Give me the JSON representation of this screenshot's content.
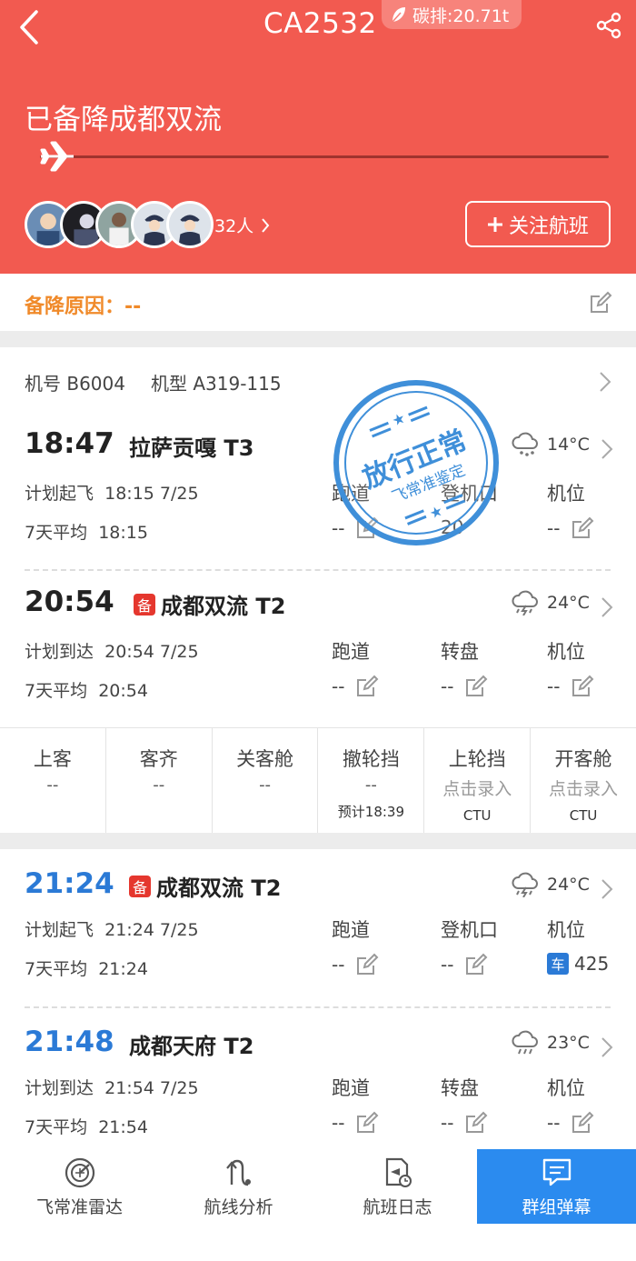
{
  "header": {
    "flight_no": "CA2532",
    "carbon": "碳排:20.71t",
    "status": "已备降成都双流",
    "progress": 0.03,
    "followers": "32人",
    "follow_label": "关注航班"
  },
  "diversion": {
    "label": "备降原因：",
    "value": "--"
  },
  "aircraft": {
    "reg_label": "机号",
    "reg": "B6004",
    "type_label": "机型",
    "type": "A319-115"
  },
  "departure": {
    "time": "18:47",
    "airport": "拉萨贡嘎 T3",
    "temp": "14°C",
    "plan_label": "计划起飞",
    "plan_value": "18:15 7/25",
    "avg_label": "7天平均",
    "avg_value": "18:15",
    "cols": [
      {
        "label": "跑道",
        "value": "--"
      },
      {
        "label": "登机口",
        "value": "20"
      },
      {
        "label": "机位",
        "value": "--"
      }
    ]
  },
  "arrival": {
    "time": "20:54",
    "divert_tag": "备",
    "airport": "成都双流 T2",
    "temp": "24°C",
    "plan_label": "计划到达",
    "plan_value": "20:54 7/25",
    "avg_label": "7天平均",
    "avg_value": "20:54",
    "cols": [
      {
        "label": "跑道",
        "value": "--"
      },
      {
        "label": "转盘",
        "value": "--"
      },
      {
        "label": "机位",
        "value": "--"
      }
    ]
  },
  "milestones": [
    {
      "title": "上客",
      "value": "--",
      "sub": ""
    },
    {
      "title": "客齐",
      "value": "--",
      "sub": ""
    },
    {
      "title": "关客舱",
      "value": "--",
      "sub": ""
    },
    {
      "title": "撤轮挡",
      "value": "--",
      "sub": "预计18:39"
    },
    {
      "title": "上轮挡",
      "value": "点击录入",
      "sub": "CTU"
    },
    {
      "title": "开客舱",
      "value": "点击录入",
      "sub": "CTU"
    }
  ],
  "leg2_departure": {
    "time": "21:24",
    "divert_tag": "备",
    "airport": "成都双流 T2",
    "temp": "24°C",
    "plan_label": "计划起飞",
    "plan_value": "21:24 7/25",
    "avg_label": "7天平均",
    "avg_value": "21:24",
    "cols": [
      {
        "label": "跑道",
        "value": "--"
      },
      {
        "label": "登机口",
        "value": "--"
      },
      {
        "label": "机位",
        "value": "425",
        "tag": "车"
      }
    ]
  },
  "leg2_arrival": {
    "time": "21:48",
    "airport": "成都天府 T2",
    "temp": "23°C",
    "plan_label": "计划到达",
    "plan_value": "21:54 7/25",
    "avg_label": "7天平均",
    "avg_value": "21:54",
    "cols": [
      {
        "label": "跑道",
        "value": "--"
      },
      {
        "label": "转盘",
        "value": "--"
      },
      {
        "label": "机位",
        "value": "--"
      }
    ]
  },
  "stamp": {
    "text_top": "放行正常",
    "text_bottom": "飞常准鉴定"
  },
  "nav": [
    {
      "label": "飞常准雷达",
      "icon": "radar-icon"
    },
    {
      "label": "航线分析",
      "icon": "route-icon"
    },
    {
      "label": "航班日志",
      "icon": "log-icon"
    },
    {
      "label": "群组弹幕",
      "icon": "chat-icon"
    }
  ],
  "colors": {
    "header_red": "#f25a50",
    "accent_blue": "#2b7ad6",
    "warning_orange": "#f08a2a"
  }
}
